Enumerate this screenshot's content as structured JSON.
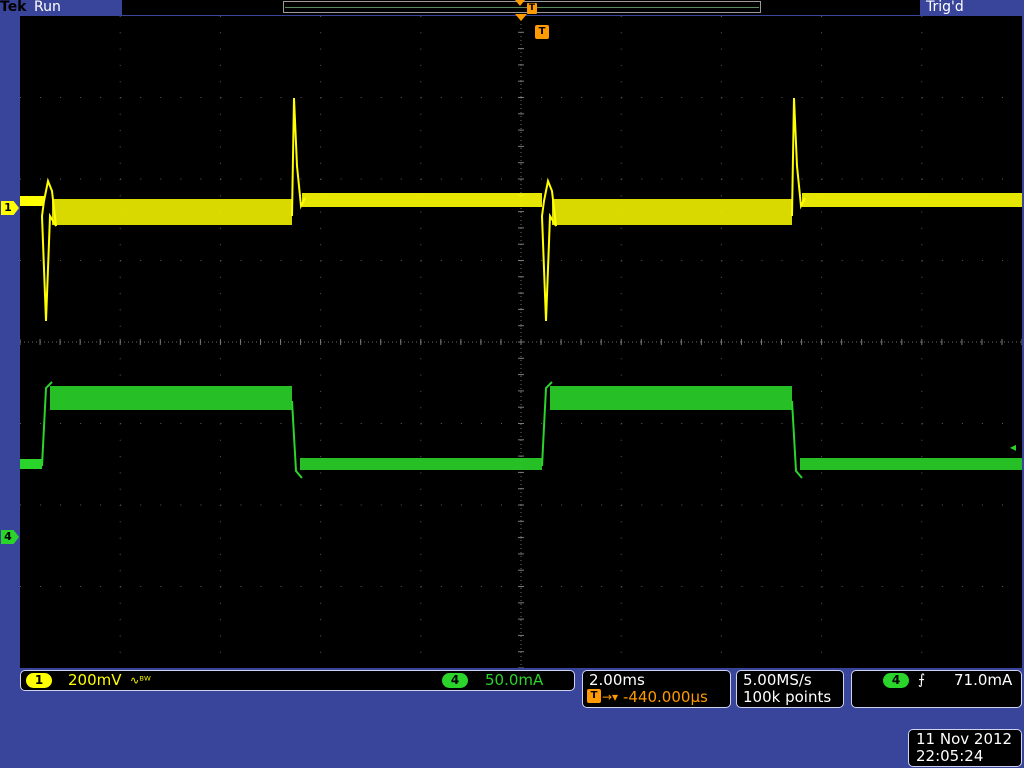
{
  "header": {
    "brand": "Tek",
    "run_state": "Run",
    "trigger_state": "Trig'd",
    "trigger_marker_letter": "T"
  },
  "channels": {
    "ch1": {
      "number": "1",
      "scale": "200mV",
      "coupling_icon": "bandwidth-limit-icon",
      "coupling_glyph": "∿ᴮᵂ",
      "color": "#ffff00"
    },
    "ch4": {
      "number": "4",
      "scale": "50.0mA",
      "color": "#2ad42a"
    }
  },
  "horizontal": {
    "time_per_div": "2.00ms",
    "delay_glyph": "→▾",
    "delay": "-440.000µs"
  },
  "acquisition": {
    "sample_rate": "5.00MS/s",
    "record_length": "100k points"
  },
  "trigger": {
    "source": "4",
    "slope_icon": "rising-edge-icon",
    "slope_glyph": "⨍",
    "level": "71.0mA",
    "level_marker_glyph": "◂"
  },
  "datetime": {
    "date": "11 Nov 2012",
    "time": "22:05:24"
  },
  "colors": {
    "background": "#39459a",
    "ch1": "#ffff00",
    "ch4": "#2ad42a",
    "trigger": "#ff9a00",
    "graticule": "#000000"
  }
}
